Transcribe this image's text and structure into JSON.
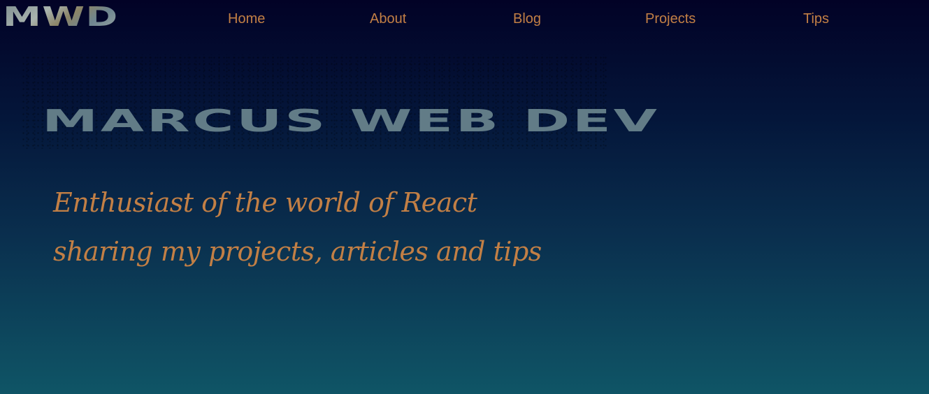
{
  "logo": {
    "text": "MWD"
  },
  "nav": {
    "items": [
      {
        "label": "Home"
      },
      {
        "label": "About"
      },
      {
        "label": "Blog"
      },
      {
        "label": "Projects"
      },
      {
        "label": "Tips"
      }
    ]
  },
  "hero": {
    "title": "MARCUS WEB DEV",
    "tagline_line1": "Enthusiast of the world of React",
    "tagline_line2": "sharing my projects, articles and tips"
  },
  "colors": {
    "accent": "#c27f45",
    "title": "#627c87",
    "bg_top": "#020226",
    "bg_bottom": "#0f5566"
  }
}
